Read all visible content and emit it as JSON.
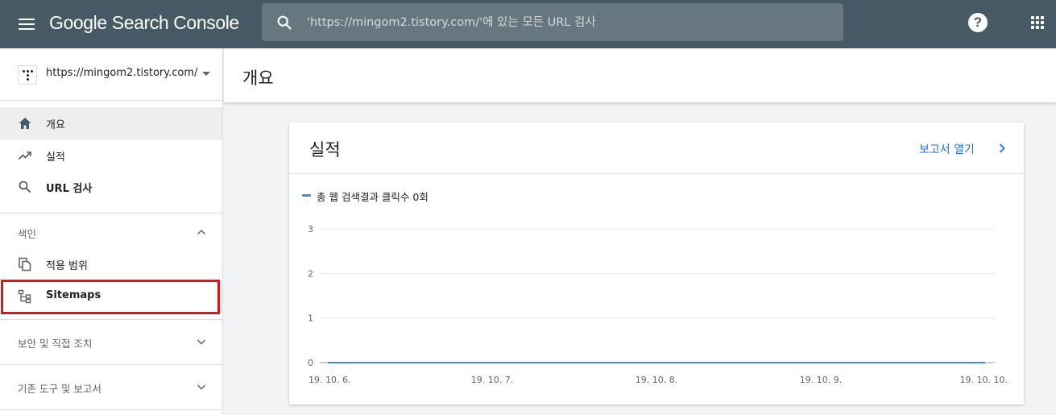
{
  "header": {
    "brand": "Google Search Console",
    "search_placeholder": "'https://mingom2.tistory.com/'에 있는 모든 URL 검사",
    "help_label": "?"
  },
  "sidebar": {
    "property_url": "https://mingom2.tistory.com/",
    "nav": [
      {
        "label": "개요",
        "icon": "home-icon",
        "active": true
      },
      {
        "label": "실적",
        "icon": "trending-up-icon",
        "active": false
      },
      {
        "label": "URL 검사",
        "icon": "search-icon",
        "active": false
      }
    ],
    "index_section": {
      "label": "색인",
      "items": [
        {
          "label": "적용 범위",
          "icon": "copy-icon"
        },
        {
          "label": "Sitemaps",
          "icon": "sitemap-icon"
        }
      ]
    },
    "security_section": {
      "label": "보안 및 직접 조치"
    },
    "legacy_section": {
      "label": "기존 도구 및 보고서"
    }
  },
  "main": {
    "page_title": "개요",
    "card": {
      "title": "실적",
      "open_report": "보고서 열기",
      "legend": "총 웹 검색결과 클릭수 0회"
    }
  },
  "colors": {
    "topbar": "#455a64",
    "accent": "#1a73e8",
    "series": "#4285f4",
    "highlight": "#e0131a"
  },
  "chart_data": {
    "type": "line",
    "x": [
      "19. 10. 6.",
      "19. 10. 7.",
      "19. 10. 8.",
      "19. 10. 9.",
      "19. 10. 10."
    ],
    "series": [
      {
        "name": "총 웹 검색결과 클릭수 0회",
        "values": [
          0,
          0,
          0,
          0,
          0
        ]
      }
    ],
    "yticks": [
      0,
      1,
      2,
      3
    ],
    "ylim": [
      0,
      3
    ],
    "grid": true
  }
}
